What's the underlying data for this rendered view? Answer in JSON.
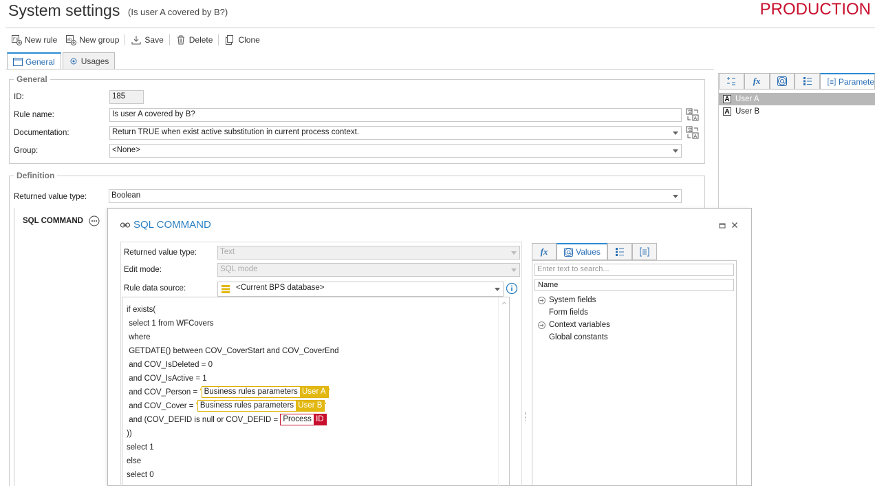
{
  "header": {
    "title": "System settings",
    "subtitle": "(Is user A covered by B?)",
    "environment": "PRODUCTION"
  },
  "toolbar": {
    "new_rule": "New rule",
    "new_group": "New group",
    "save": "Save",
    "delete": "Delete",
    "clone": "Clone"
  },
  "tabs": {
    "general": "General",
    "usages": "Usages"
  },
  "general": {
    "legend": "General",
    "id_label": "ID:",
    "id_value": "185",
    "rule_name_label": "Rule name:",
    "rule_name_value": "Is user A covered by B?",
    "documentation_label": "Documentation:",
    "documentation_value": "Return TRUE when exist active substitution in current process context.",
    "group_label": "Group:",
    "group_value": "<None>"
  },
  "definition": {
    "legend": "Definition",
    "return_type_label": "Returned value type:",
    "return_type_value": "Boolean",
    "sql_command_label": "SQL COMMAND"
  },
  "right_panel": {
    "active_tab": "Paramete",
    "params": [
      {
        "name": "User A",
        "selected": true
      },
      {
        "name": "User B",
        "selected": false
      }
    ]
  },
  "modal": {
    "title": "SQL COMMAND",
    "return_type_label": "Returned value type:",
    "return_type_value": "Text",
    "edit_mode_label": "Edit mode:",
    "edit_mode_value": "SQL mode",
    "data_source_label": "Rule data source:",
    "data_source_value": "<Current BPS database>",
    "code": {
      "l1": "if exists(",
      "l2": " select 1 from WFCovers",
      "l3": " where",
      "l4": " GETDATE() between COV_CoverStart and COV_CoverEnd",
      "l5": " and COV_IsDeleted = 0",
      "l6": " and COV_IsActive = 1",
      "l7_pre": " and COV_Person = ",
      "l7_chip": "Business rules parameters",
      "l7_tag": "User A",
      "l8_pre": " and COV_Cover = ",
      "l8_chip": "Business rules parameters",
      "l8_tag": "User B",
      "l9_pre": " and (COV_DEFID is null or COV_DEFID = ",
      "l9_chip": "Process",
      "l9_tag": "ID",
      "l10": "))",
      "l11": "select 1",
      "l12": "else",
      "l13": "select 0",
      "quote": "'"
    },
    "values_panel": {
      "active_tab": "Values",
      "search_placeholder": "Enter text to search...",
      "column_header": "Name",
      "items": [
        "System fields",
        "Form fields",
        "Context variables",
        "Global constants"
      ]
    }
  },
  "colors": {
    "accent": "#2a8ad4",
    "production": "#c8102e",
    "param_chip": "#e2b811",
    "process_chip": "#c8102e"
  }
}
